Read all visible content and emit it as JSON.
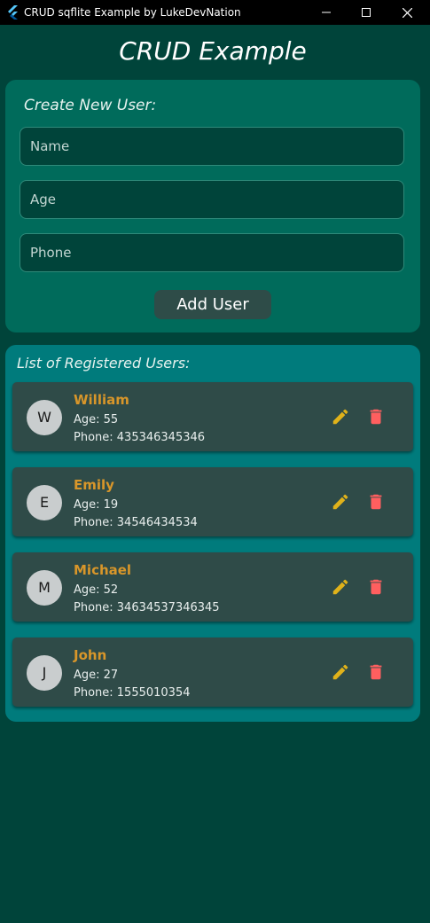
{
  "window": {
    "title": "CRUD sqflite Example by LukeDevNation",
    "controls": [
      "minimize-icon",
      "maximize-icon",
      "close-icon"
    ]
  },
  "page": {
    "title": "CRUD Example"
  },
  "create_form": {
    "title": "Create New User:",
    "fields": {
      "name": {
        "placeholder": "Name",
        "value": ""
      },
      "age": {
        "placeholder": "Age",
        "value": ""
      },
      "phone": {
        "placeholder": "Phone",
        "value": ""
      }
    },
    "submit_label": "Add User"
  },
  "user_list": {
    "title": "List of Registered Users:",
    "users": [
      {
        "initial": "W",
        "name": "William",
        "age": "Age: 55",
        "phone": "Phone: 435346345346"
      },
      {
        "initial": "E",
        "name": "Emily",
        "age": "Age: 19",
        "phone": "Phone: 34546434534"
      },
      {
        "initial": "M",
        "name": "Michael",
        "age": "Age: 52",
        "phone": "Phone: 34634537346345"
      },
      {
        "initial": "J",
        "name": "John",
        "age": "Age: 27",
        "phone": "Phone: 1555010354"
      }
    ],
    "actions": [
      "edit-icon",
      "delete-icon"
    ]
  },
  "colors": {
    "background": "#00443a",
    "form_card": "#006b5b",
    "list_card": "#007b7c",
    "user_card": "#2f4b48",
    "name_accent": "#d8962a",
    "edit_icon": "#e0b21a",
    "delete_icon": "#ff5f5f"
  }
}
